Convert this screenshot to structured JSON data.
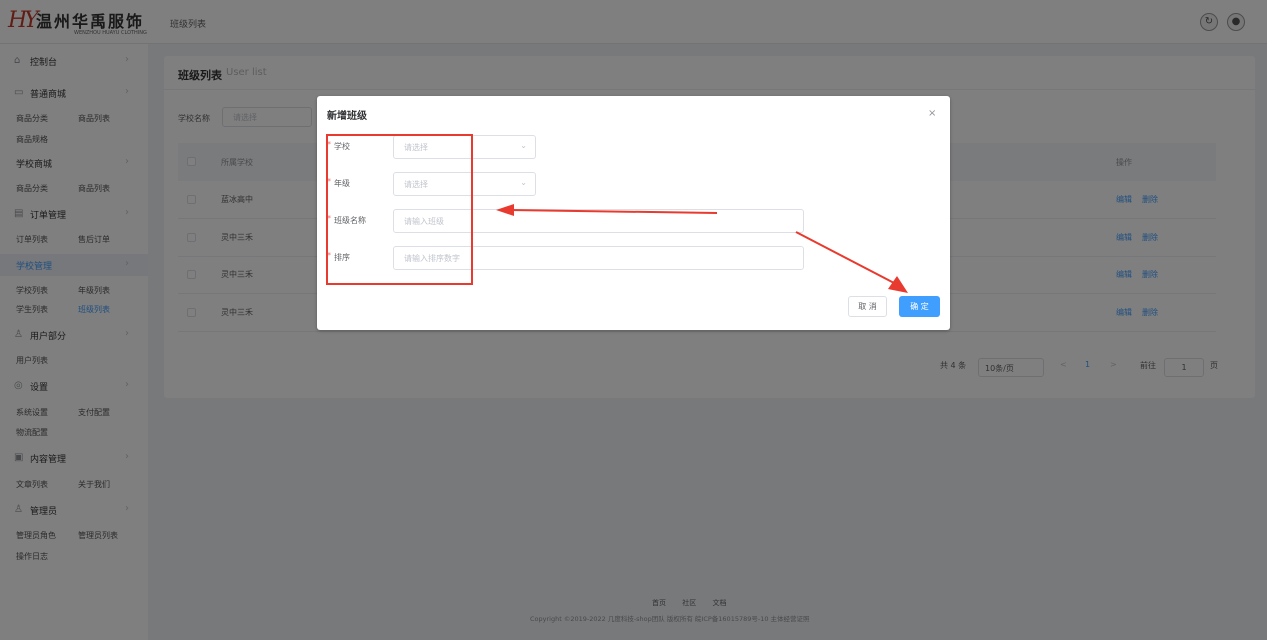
{
  "header": {
    "logo_cn": "温州华禹服饰",
    "logo_en": "WENZHOU HUAYU CLOTHING",
    "breadcrumb": "班级列表"
  },
  "sidebar": {
    "dashboard": "控制台",
    "mall": "普通商城",
    "mall_cat": "商品分类",
    "mall_list": "商品列表",
    "mall_spec": "商品规格",
    "school_mall": "学校商城",
    "school_cat": "商品分类",
    "school_list": "商品列表",
    "order_mgmt": "订单管理",
    "order_list": "订单列表",
    "after_sale": "售后订单",
    "school_mgmt": "学校管理",
    "school_list2": "学校列表",
    "grade_list": "年级列表",
    "student_list": "学生列表",
    "class_list": "班级列表",
    "user_part": "用户部分",
    "user_list": "用户列表",
    "settings": "设置",
    "sys_settings": "系统设置",
    "pay_settings": "支付配置",
    "logistics": "物流配置",
    "content": "内容管理",
    "articles": "文章列表",
    "about": "关于我们",
    "admin": "管理员",
    "admin_roles": "管理员角色",
    "admin_list": "管理员列表",
    "op_log": "操作日志"
  },
  "card": {
    "title": "班级列表",
    "subtitle": "User list",
    "filter_label": "学校名称",
    "filter_placeholder": "请选择",
    "col_school": "所属学校",
    "col_ops": "操作",
    "rows": [
      {
        "school": "蓝冰高中",
        "edit": "编辑",
        "del": "删除"
      },
      {
        "school": "灵中三禾",
        "edit": "编辑",
        "del": "删除"
      },
      {
        "school": "灵中三禾",
        "edit": "编辑",
        "del": "删除"
      },
      {
        "school": "灵中三禾",
        "edit": "编辑",
        "del": "删除"
      }
    ],
    "pager_total": "共 4 条",
    "pager_size": "10条/页",
    "pager_prev": "<",
    "pager_page": "1",
    "pager_next": ">",
    "pager_goto": "前往",
    "pager_input": "1",
    "pager_unit": "页"
  },
  "footer": {
    "links": "首页 社区 文档",
    "copyright": "Copyright ©2019-2022 几度科技-shop团队 版权所有 皖ICP备16015789号-10 主体经营证照"
  },
  "dialog": {
    "title": "新增班级",
    "close": "×",
    "school_label": "学校",
    "school_placeholder": "请选择",
    "grade_label": "年级",
    "grade_placeholder": "请选择",
    "class_label": "班级名称",
    "class_placeholder": "请输入班级",
    "sort_label": "排序",
    "sort_placeholder": "请输入排序数字",
    "cancel": "取 消",
    "ok": "确 定"
  }
}
